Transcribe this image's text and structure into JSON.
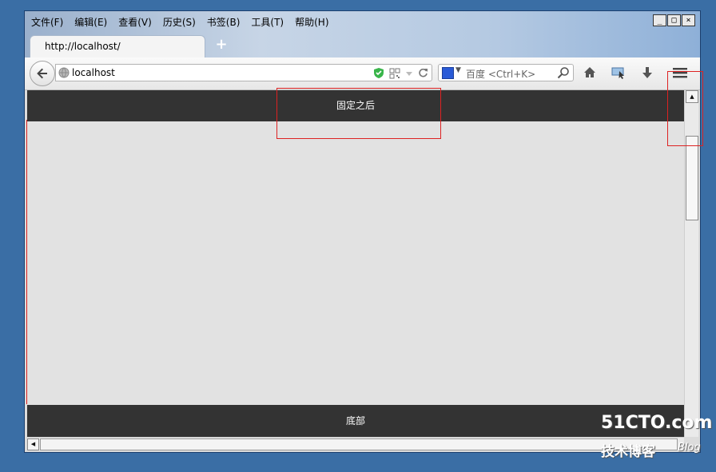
{
  "browser": {
    "menu": [
      "文件(F)",
      "编辑(E)",
      "查看(V)",
      "历史(S)",
      "书签(B)",
      "工具(T)",
      "帮助(H)"
    ],
    "window_controls": {
      "minimize": "_",
      "maximize": "□",
      "close": "×"
    },
    "tab": {
      "title": "http://localhost/"
    },
    "new_tab_label": "+",
    "url": {
      "value": "localhost"
    },
    "search": {
      "placeholder": "百度 <Ctrl+K>"
    },
    "accent_color": "#3a6ea5"
  },
  "page": {
    "header_text": "固定之后",
    "footer_text": "底部"
  },
  "watermark": {
    "site": "51CTO.com",
    "tagline": "技术博客",
    "blog": "Blog"
  }
}
